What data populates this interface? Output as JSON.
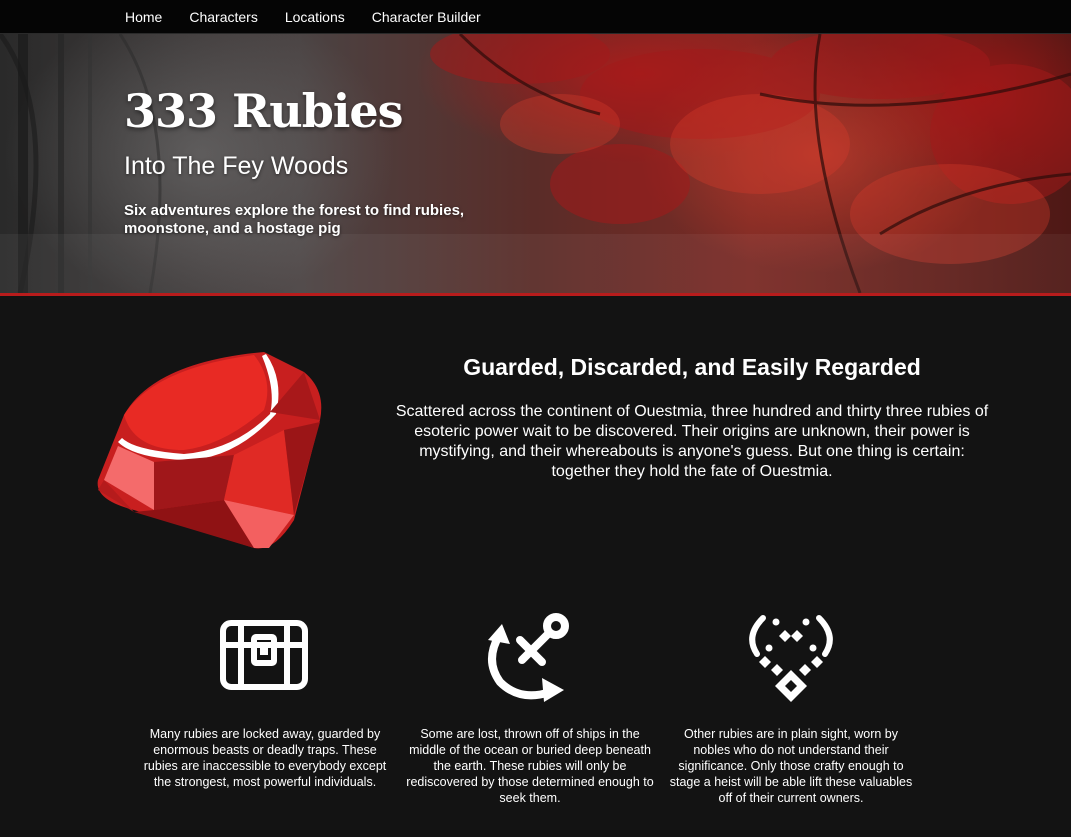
{
  "nav": {
    "items": [
      "Home",
      "Characters",
      "Locations",
      "Character Builder"
    ]
  },
  "hero": {
    "title": "333 Rubies",
    "subtitle": "Into The Fey Woods",
    "tagline": "Six adventures explore the forest to find rubies, moonstone, and a hostage pig"
  },
  "intro": {
    "heading": "Guarded, Discarded, and Easily Regarded",
    "body": "Scattered across the continent of Ouestmia, three hundred and thirty three rubies of esoteric power wait to be discovered. Their origins are unknown, their power is mystifying, and their whereabouts is anyone's guess. But one thing is certain: together they hold the fate of Ouestmia."
  },
  "features": [
    {
      "icon": "treasure-chest-icon",
      "text": "Many rubies are locked away, guarded by enormous beasts or deadly traps. These rubies are inaccessible to everybody except the strongest, most powerful individuals."
    },
    {
      "icon": "anchor-icon",
      "text": "Some are lost, thrown off of ships in the middle of the ocean or buried deep beneath the earth. These rubies will only be rediscovered by those determined enough to seek them."
    },
    {
      "icon": "necklace-icon",
      "text": "Other rubies are in plain sight, worn by nobles who do not understand their significance. Only those crafty enough to stage a heist will be able lift these valuables off of their current owners."
    }
  ],
  "colors": {
    "background": "#131313",
    "navbar": "#050505",
    "accent_border": "#b81c1c",
    "ruby": "#d42424"
  }
}
